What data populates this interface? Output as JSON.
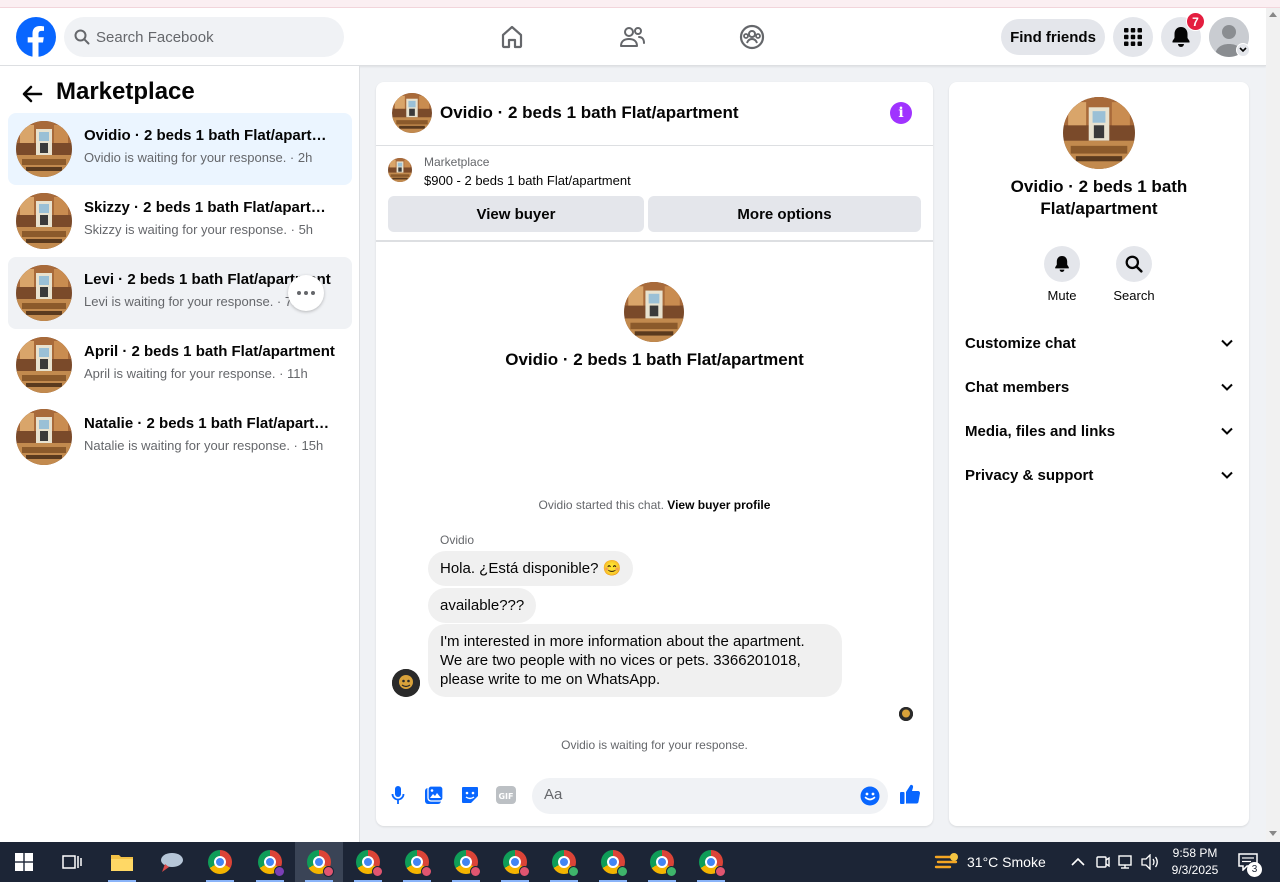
{
  "header": {
    "search_placeholder": "Search Facebook",
    "find_friends": "Find friends",
    "notification_count": "7"
  },
  "sidebar": {
    "title": "Marketplace",
    "conversations": [
      {
        "name": "Ovidio · 2 beds 1 bath Flat/apartment",
        "sub": "Ovidio is waiting for your response. · 2h"
      },
      {
        "name": "Skizzy · 2 beds 1 bath Flat/apartment",
        "sub": "Skizzy is waiting for your response. · 5h"
      },
      {
        "name": "Levi · 2 beds 1 bath Flat/apartment",
        "sub": "Levi is waiting for your response. · 7h"
      },
      {
        "name": "April · 2 beds 1 bath Flat/apartment",
        "sub": "April is waiting for your response. · 11h"
      },
      {
        "name": "Natalie · 2 beds 1 bath Flat/apartment",
        "sub": "Natalie is waiting for your response. · 15h"
      }
    ]
  },
  "chat": {
    "title": "Ovidio · 2 beds 1 bath Flat/apartment",
    "listing_label": "Marketplace",
    "listing_price": "$900 - 2 beds 1 bath Flat/apartment",
    "view_buyer": "View buyer",
    "more_options": "More options",
    "intro_title": "Ovidio · 2 beds 1 bath Flat/apartment",
    "started_text": "Ovidio started this chat.",
    "view_buyer_profile": "View buyer profile",
    "sender": "Ovidio",
    "messages": [
      "Hola. ¿Está disponible? 😊",
      "available???",
      "I'm interested in more information about the apartment.\nWe are two people with no vices or pets. 3366201018,\nplease write to me on WhatsApp."
    ],
    "waiting": "Ovidio is waiting for your response.",
    "input_placeholder": "Aa"
  },
  "info_panel": {
    "name": "Ovidio · 2 beds 1 bath Flat/apartment",
    "mute": "Mute",
    "search": "Search",
    "sections": [
      "Customize chat",
      "Chat members",
      "Media, files and links",
      "Privacy & support"
    ]
  },
  "taskbar": {
    "weather": "31°C  Smoke",
    "time": "9:58 PM",
    "date": "9/3/2025",
    "notif_count": "3"
  },
  "colors": {
    "brand": "#0866ff",
    "active_row": "#ebf5ff",
    "info_purple": "#a033ff",
    "badge_red": "#e41e3f",
    "taskbar": "#1c2536"
  }
}
